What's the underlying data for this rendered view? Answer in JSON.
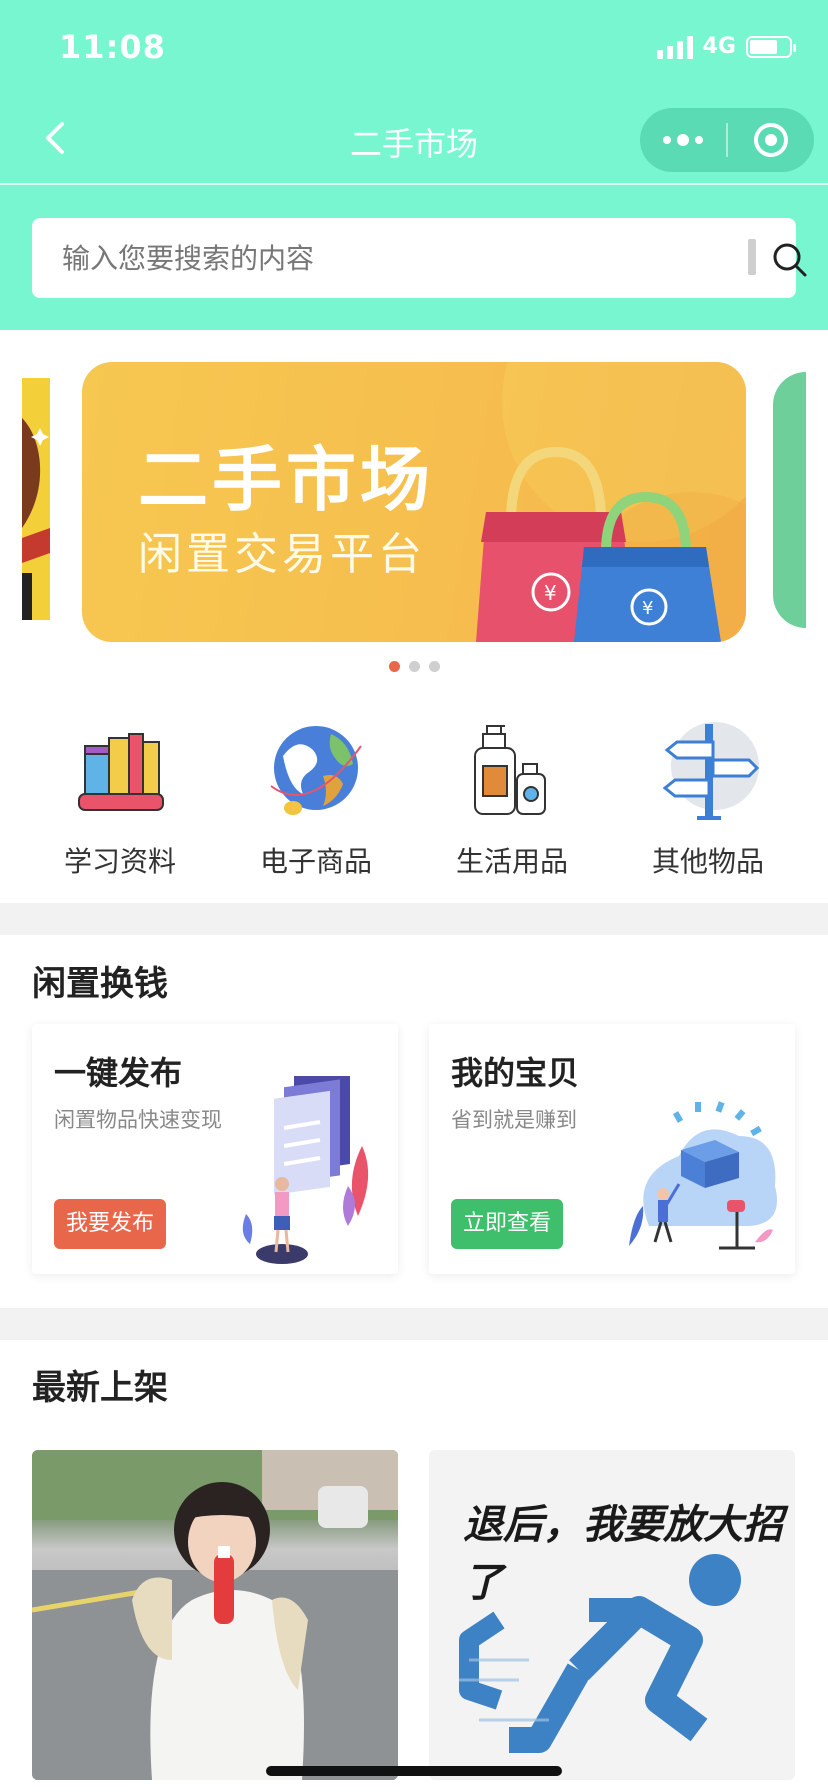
{
  "status": {
    "time": "11:08",
    "network": "4G",
    "battery_level": 0.7
  },
  "nav": {
    "title": "二手市场"
  },
  "search": {
    "placeholder": "输入您要搜索的内容"
  },
  "banner": {
    "title": "二手市场",
    "subtitle": "闲置交易平台",
    "dots": 3,
    "active_dot": 0
  },
  "categories": [
    {
      "label": "学习资料",
      "icon": "books-icon"
    },
    {
      "label": "电子商品",
      "icon": "globe-icon"
    },
    {
      "label": "生活用品",
      "icon": "bottles-icon"
    },
    {
      "label": "其他物品",
      "icon": "signpost-icon"
    }
  ],
  "idle_section": {
    "title": "闲置换钱",
    "cards": [
      {
        "title": "一键发布",
        "desc": "闲置物品快速变现",
        "button": "我要发布",
        "button_color": "#e8664a"
      },
      {
        "title": "我的宝贝",
        "desc": "省到就是赚到",
        "button": "立即查看",
        "button_color": "#3fbf6c"
      }
    ]
  },
  "latest_section": {
    "title": "最新上架",
    "items": [
      {
        "type": "photo"
      },
      {
        "type": "poster",
        "text": "退后，我要放大招了"
      }
    ]
  },
  "colors": {
    "header": "#78f6d0",
    "accent_red": "#e8664a",
    "accent_green": "#3fbf6c"
  }
}
